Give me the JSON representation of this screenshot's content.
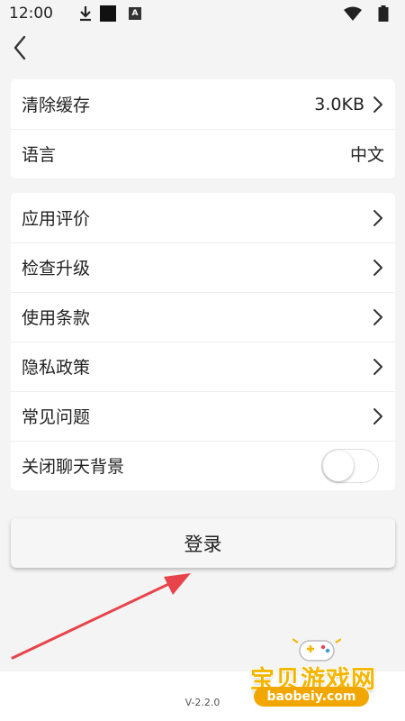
{
  "status_bar": {
    "time": "12:00",
    "icons": [
      "download-icon",
      "black-square-icon",
      "a-badge-icon",
      "wifi-icon",
      "battery-icon"
    ],
    "badge_letter": "A"
  },
  "nav": {
    "back_icon": "chevron-left-icon"
  },
  "settings_group_1": [
    {
      "label": "清除缓存",
      "value": "3.0KB",
      "chevron": true
    },
    {
      "label": "语言",
      "value": "中文",
      "chevron": false
    }
  ],
  "settings_group_2": [
    {
      "label": "应用评价",
      "chevron": true
    },
    {
      "label": "检查升级",
      "chevron": true
    },
    {
      "label": "使用条款",
      "chevron": true
    },
    {
      "label": "隐私政策",
      "chevron": true
    },
    {
      "label": "常见问题",
      "chevron": true
    },
    {
      "label": "关闭聊天背景",
      "toggle": false
    }
  ],
  "login_button": "登录",
  "version": "V-2.2.0",
  "watermark": {
    "title": "宝贝游戏网",
    "url": "baobeiy.com"
  },
  "colors": {
    "background": "#f4f4f4",
    "card": "#ffffff",
    "annotation_arrow": "#e8434a",
    "watermark": "#f5b600"
  }
}
